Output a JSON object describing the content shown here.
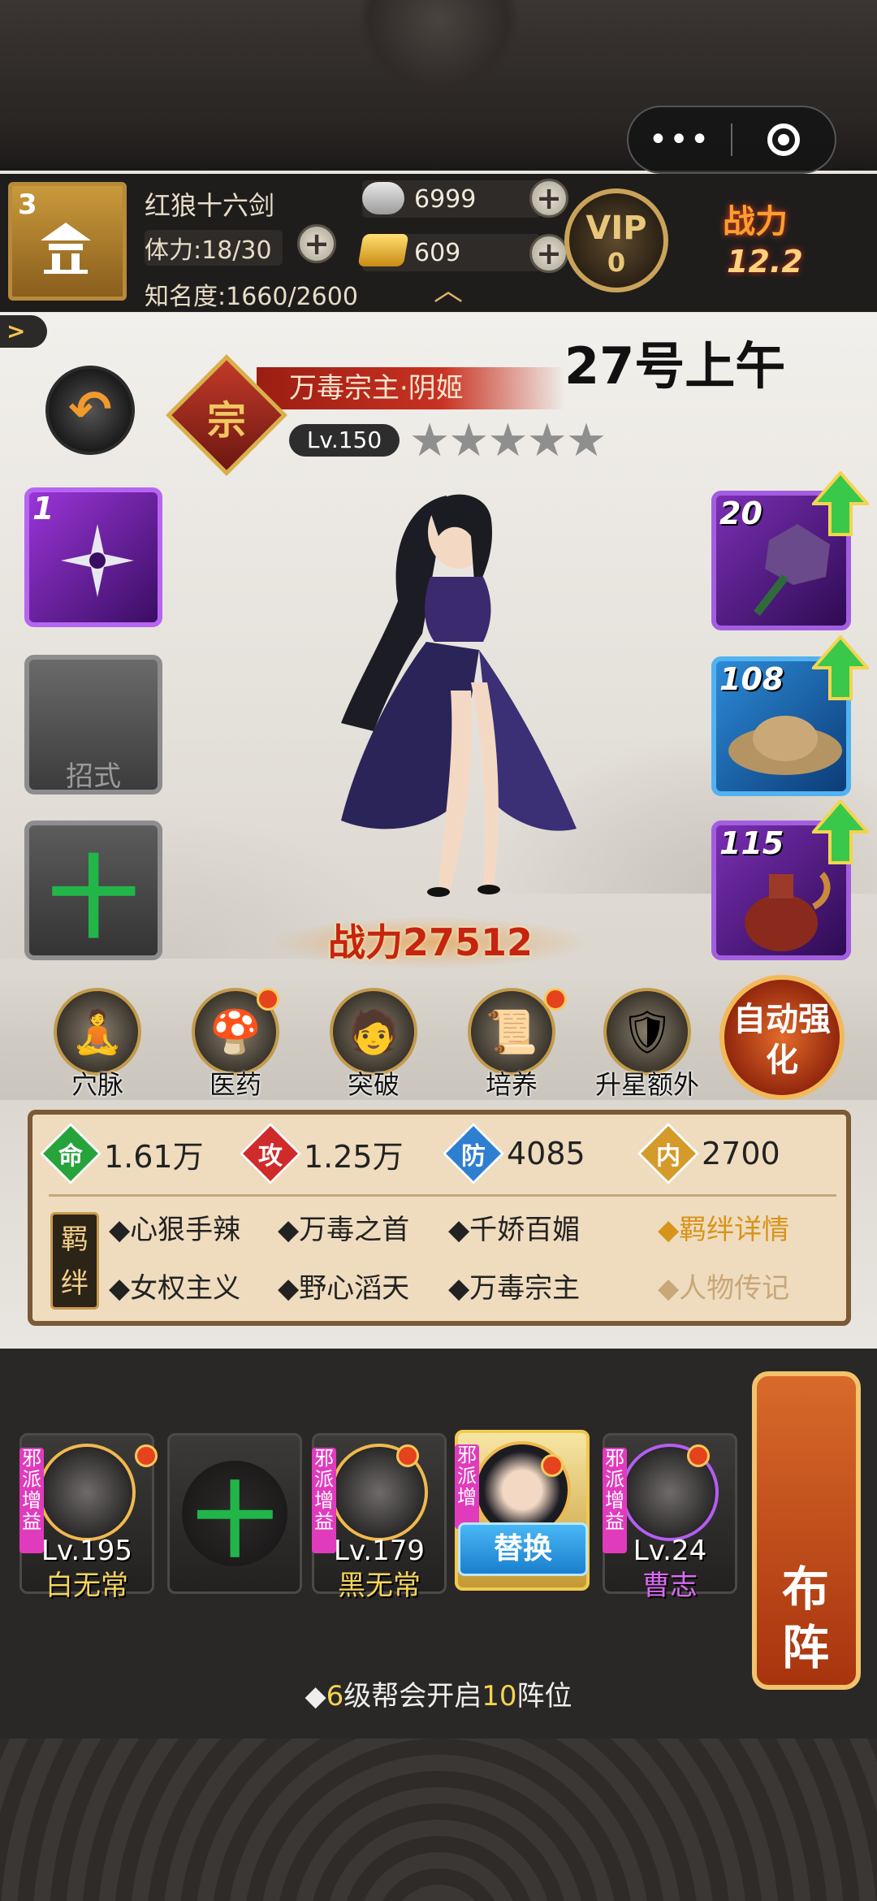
{
  "capsule": {
    "more_icon": "more-dots-icon",
    "close_icon": "target-icon"
  },
  "player": {
    "level": "3",
    "name": "红狼十六剑",
    "stamina": "体力:18/30",
    "fame": "知名度:1660/2600",
    "silver": "6999",
    "gold": "609",
    "vip_label": "VIP",
    "vip_level": "0",
    "power_label": "战力",
    "power_value": "12.2"
  },
  "overlay_date": "27号上午",
  "hero": {
    "rank": "宗",
    "title": "万毒宗主·阴姬",
    "level": "Lv.150",
    "stars": "★★★★★",
    "skill_count": "1",
    "move_label": "招式",
    "add_symbol": "十",
    "power": "战力27512",
    "equipment": [
      {
        "num": "20",
        "icon": "spiked-mace-icon"
      },
      {
        "num": "108",
        "icon": "straw-hat-icon"
      },
      {
        "num": "115",
        "icon": "wine-pot-icon"
      }
    ]
  },
  "functions": [
    {
      "label": "穴脉",
      "icon": "meridian-icon"
    },
    {
      "label": "医药",
      "icon": "medicine-icon"
    },
    {
      "label": "突破",
      "icon": "breakthrough-icon"
    },
    {
      "label": "培养",
      "icon": "scroll-icon"
    },
    {
      "label": "升星额外",
      "icon": "star-up-icon"
    }
  ],
  "auto_enhance": "自动强化",
  "stats": [
    {
      "key": "命",
      "value": "1.61万",
      "color": "#27a33c"
    },
    {
      "key": "攻",
      "value": "1.25万",
      "color": "#cf2b2b"
    },
    {
      "key": "防",
      "value": "4085",
      "color": "#2f7fd1"
    },
    {
      "key": "内",
      "value": "2700",
      "color": "#d49b2a"
    }
  ],
  "bonds": {
    "tag": "羁绊",
    "row1": [
      "◆心狠手辣",
      "◆万毒之首",
      "◆千娇百媚"
    ],
    "row2": [
      "◆女权主义",
      "◆野心滔天",
      "◆万毒宗主"
    ],
    "detail_link": "◆羁绊详情",
    "bio_link": "◆人物传记"
  },
  "lineup": {
    "cards": [
      {
        "level": "Lv.195",
        "name": "白无常",
        "tag": "邪派增益"
      },
      {
        "empty": true
      },
      {
        "level": "Lv.179",
        "name": "黑无常",
        "tag": "邪派增益"
      },
      {
        "selected": true,
        "tag": "邪派增"
      },
      {
        "level": "Lv.24",
        "name": "曹志",
        "tag": "邪派增益"
      }
    ],
    "swap_label": "替换",
    "formation_label": "布阵",
    "tip_prefix": "◆",
    "tip_num1": "6",
    "tip_mid": "级帮会开启",
    "tip_num2": "10",
    "tip_suffix": "阵位"
  }
}
